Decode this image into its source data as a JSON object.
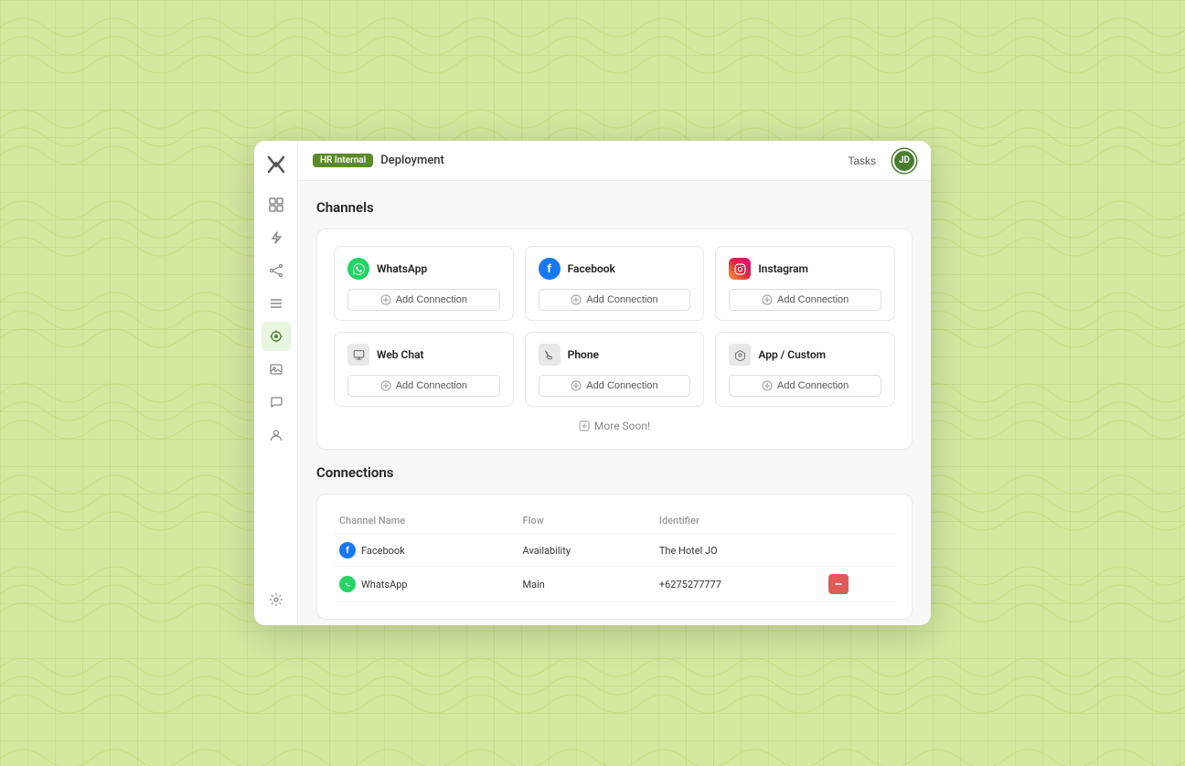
{
  "app": {
    "badge": "HR Internal",
    "page_title": "Deployment",
    "tasks_label": "Tasks",
    "avatar_initials": "JD"
  },
  "sidebar": {
    "logo_icon": "x-icon",
    "items": [
      {
        "id": "grid",
        "icon": "grid-icon",
        "active": false
      },
      {
        "id": "lightning",
        "icon": "lightning-icon",
        "active": false
      },
      {
        "id": "share",
        "icon": "share-icon",
        "active": false
      },
      {
        "id": "list",
        "icon": "list-icon",
        "active": false
      },
      {
        "id": "deploy",
        "icon": "deploy-icon",
        "active": true
      },
      {
        "id": "image",
        "icon": "image-icon",
        "active": false
      },
      {
        "id": "chat",
        "icon": "chat-icon",
        "active": false
      },
      {
        "id": "user",
        "icon": "user-icon",
        "active": false
      }
    ],
    "bottom_items": [
      {
        "id": "settings",
        "icon": "settings-icon"
      }
    ]
  },
  "channels": {
    "section_title": "Channels",
    "cards": [
      {
        "id": "whatsapp",
        "name": "WhatsApp",
        "icon_type": "whatsapp",
        "add_label": "Add Connection"
      },
      {
        "id": "facebook",
        "name": "Facebook",
        "icon_type": "facebook",
        "add_label": "Add Connection"
      },
      {
        "id": "instagram",
        "name": "Instagram",
        "icon_type": "instagram",
        "add_label": "Add Connection"
      },
      {
        "id": "webchat",
        "name": "Web Chat",
        "icon_type": "webchat",
        "add_label": "Add Connection"
      },
      {
        "id": "phone",
        "name": "Phone",
        "icon_type": "phone",
        "add_label": "Add Connection"
      },
      {
        "id": "appcustom",
        "name": "App / Custom",
        "icon_type": "appcustom",
        "add_label": "Add Connection"
      }
    ],
    "more_soon_label": "More Soon!"
  },
  "connections": {
    "section_title": "Connections",
    "columns": {
      "channel": "Channel Name",
      "flow": "Flow",
      "identifier": "Identifier"
    },
    "rows": [
      {
        "id": "conn-facebook",
        "channel_name": "Facebook",
        "icon_type": "facebook",
        "flow": "Availability",
        "identifier": "The Hotel JO",
        "has_delete": false
      },
      {
        "id": "conn-whatsapp",
        "channel_name": "WhatsApp",
        "icon_type": "whatsapp",
        "flow": "Main",
        "identifier": "+6275277777",
        "has_delete": true
      }
    ]
  }
}
